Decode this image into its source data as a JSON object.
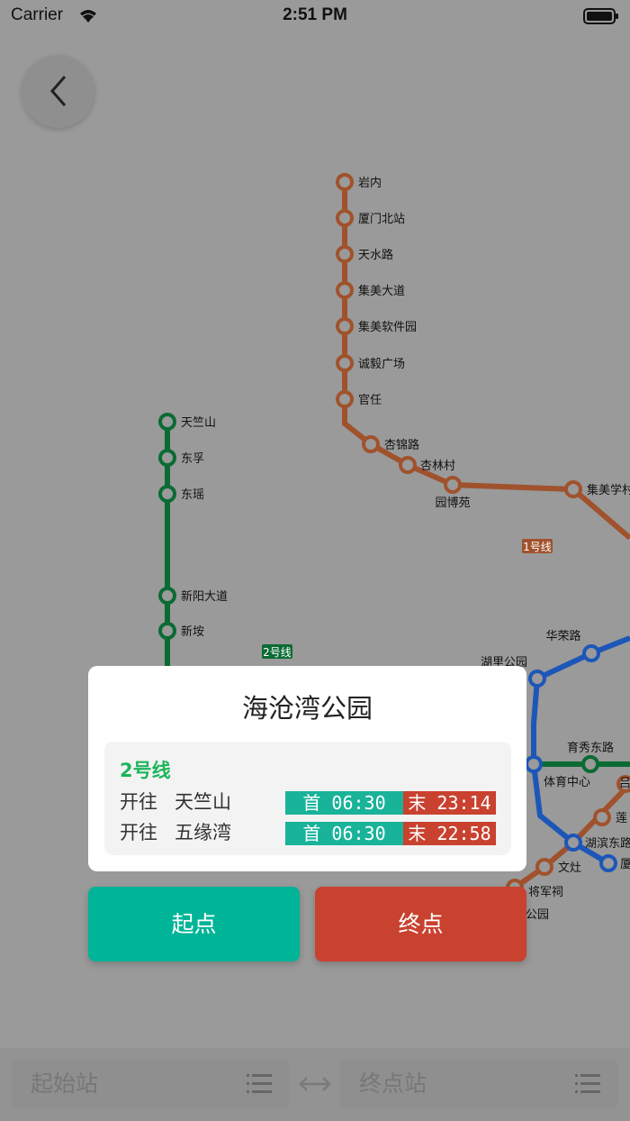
{
  "status_bar": {
    "carrier": "Carrier",
    "time": "2:51 PM"
  },
  "map": {
    "line1": {
      "label": "1号线",
      "color": "#a0522d",
      "stations": [
        "岩内",
        "厦门北站",
        "天水路",
        "集美大道",
        "集美软件园",
        "诚毅广场",
        "官任",
        "杏锦路",
        "杏林村",
        "园博苑",
        "集美学村"
      ]
    },
    "line2": {
      "label": "2号线",
      "color": "#0b6b34",
      "stations": [
        "天竺山",
        "东孚",
        "东瑶",
        "新阳大道",
        "新垵"
      ]
    },
    "other_stations": [
      "华荣路",
      "湖里公园",
      "育秀东路",
      "体育中心",
      "吕",
      "莲",
      "湖滨东路",
      "厦",
      "文灶",
      "将军祠",
      "公园"
    ],
    "line3_color": "#1c57b8"
  },
  "popup": {
    "station_name": "海沧湾公园",
    "line_name": "2号线",
    "directions": [
      {
        "label": "开往",
        "station": "天竺山",
        "first": "首 06:30",
        "last": "末 23:14"
      },
      {
        "label": "开往",
        "station": "五缘湾",
        "first": "首 06:30",
        "last": "末 22:58"
      }
    ]
  },
  "actions": {
    "start_label": "起点",
    "end_label": "终点"
  },
  "bottom_bar": {
    "from_placeholder": "起始站",
    "to_placeholder": "终点站"
  },
  "colors": {
    "start": "#00b497",
    "end": "#c9412f",
    "first_tag": "#19b39a",
    "line_name": "#1bb55c"
  }
}
